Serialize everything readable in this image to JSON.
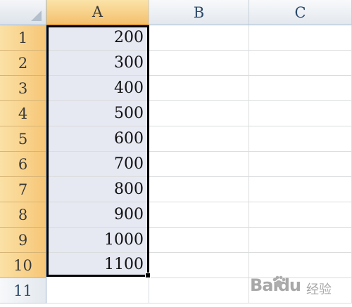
{
  "columns": [
    "A",
    "B",
    "C"
  ],
  "rows": [
    "1",
    "2",
    "3",
    "4",
    "5",
    "6",
    "7",
    "8",
    "9",
    "10",
    "11"
  ],
  "column_a_values": [
    "200",
    "300",
    "400",
    "500",
    "600",
    "700",
    "800",
    "900",
    "1000",
    "1100"
  ],
  "watermark": {
    "logo": "Baidu",
    "text": "经验"
  },
  "colors": {
    "selection_fill": "#e6e8f2",
    "header_highlight": "#f6c676",
    "gridline": "#dadcdd"
  }
}
